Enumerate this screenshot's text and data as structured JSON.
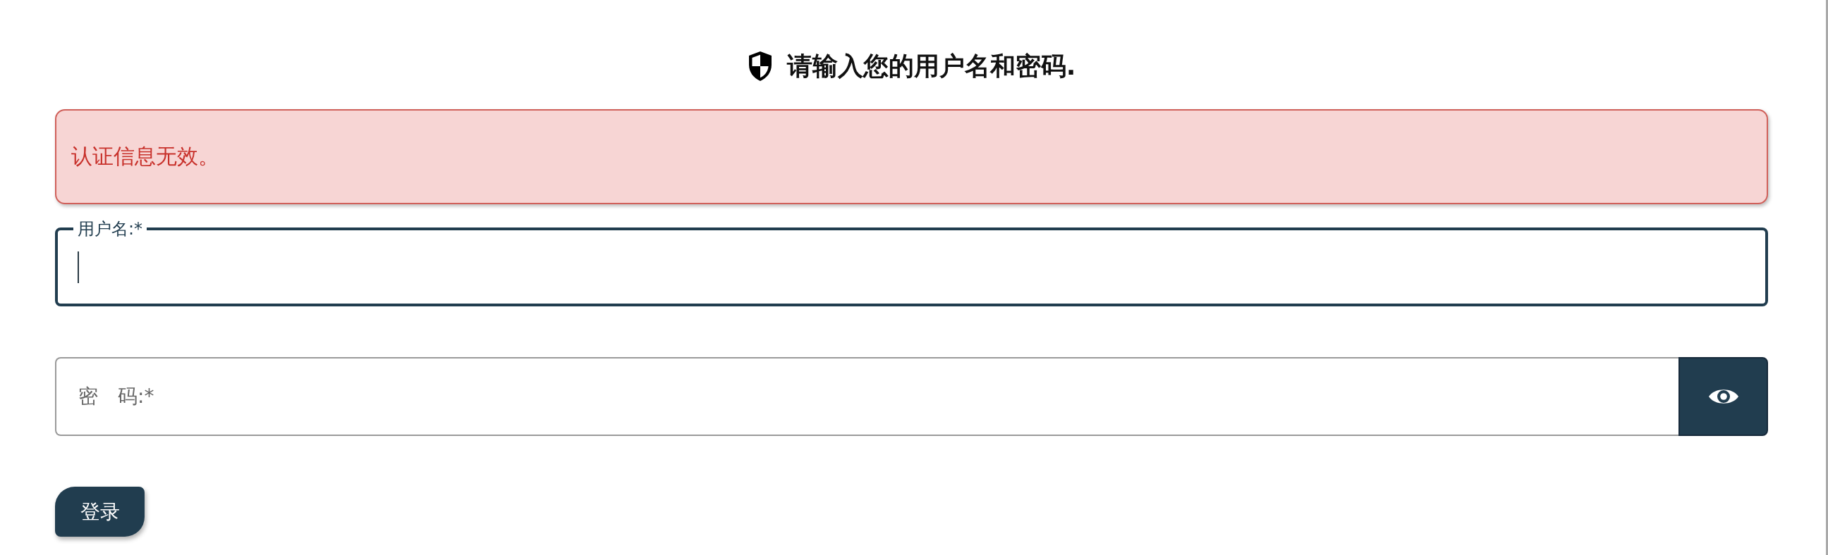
{
  "header": {
    "title": "请输入您的用户名和密码."
  },
  "alert": {
    "kind": "error",
    "message": "认证信息无效。"
  },
  "fields": [
    {
      "kind": "text",
      "label": "用户名:*",
      "focused": true
    },
    {
      "kind": "password",
      "label": "密　码:*",
      "focused": false
    }
  ],
  "submit_button": {
    "label": "登录"
  }
}
